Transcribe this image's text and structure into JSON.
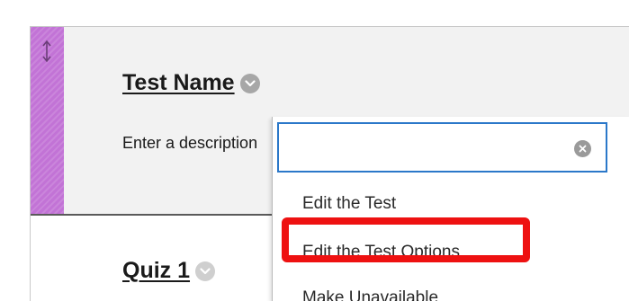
{
  "content": {
    "test_item": {
      "title": "Test Name",
      "description": "Enter a description"
    },
    "quiz_item": {
      "title": "Quiz 1"
    }
  },
  "menu": {
    "search": {
      "value": "",
      "placeholder": ""
    },
    "items": [
      {
        "label": "Edit the Test"
      },
      {
        "label": "Edit the Test Options"
      },
      {
        "label": "Make Unavailable"
      }
    ],
    "highlighted_item_index": 1
  },
  "colors": {
    "drag_handle": "#c273d6",
    "focus_border": "#2b78c9",
    "highlight": "#ee1111",
    "selected_row_bg": "#f2f2f2"
  },
  "icons": {
    "drag": "vertical-double-arrow-icon",
    "options": "chevron-down-circle-icon",
    "clear": "clear-x-circle-icon"
  }
}
